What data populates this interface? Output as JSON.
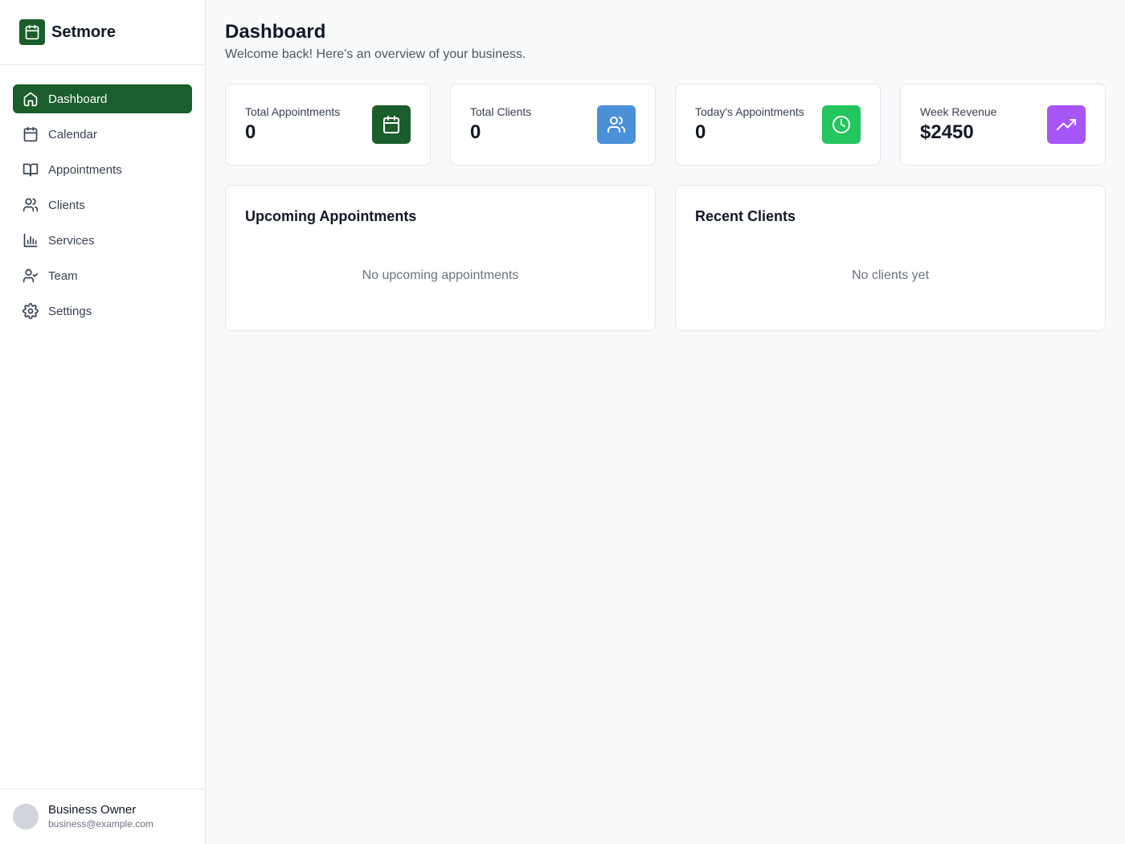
{
  "brand": {
    "name": "Setmore",
    "icon": "calendar-icon",
    "color": "#1b5e2b"
  },
  "sidebar": {
    "items": [
      {
        "label": "Dashboard",
        "icon": "home-icon",
        "active": true
      },
      {
        "label": "Calendar",
        "icon": "calendar-icon",
        "active": false
      },
      {
        "label": "Appointments",
        "icon": "book-open-icon",
        "active": false
      },
      {
        "label": "Clients",
        "icon": "users-icon",
        "active": false
      },
      {
        "label": "Services",
        "icon": "bar-chart-icon",
        "active": false
      },
      {
        "label": "Team",
        "icon": "user-check-icon",
        "active": false
      },
      {
        "label": "Settings",
        "icon": "gear-icon",
        "active": false
      }
    ]
  },
  "user": {
    "name": "Business Owner",
    "email": "business@example.com"
  },
  "header": {
    "title": "Dashboard",
    "subtitle": "Welcome back! Here's an overview of your business."
  },
  "stats": [
    {
      "label": "Total Appointments",
      "value": "0",
      "icon": "calendar-icon",
      "color": "#1b5e2b"
    },
    {
      "label": "Total Clients",
      "value": "0",
      "icon": "users-icon",
      "color": "#4a90d9"
    },
    {
      "label": "Today's Appointments",
      "value": "0",
      "icon": "clock-icon",
      "color": "#22c55e"
    },
    {
      "label": "Week Revenue",
      "value": "$2450",
      "icon": "trending-up-icon",
      "color": "#a855f7"
    }
  ],
  "panels": {
    "upcoming": {
      "title": "Upcoming Appointments",
      "empty": "No upcoming appointments"
    },
    "recent": {
      "title": "Recent Clients",
      "empty": "No clients yet"
    }
  }
}
